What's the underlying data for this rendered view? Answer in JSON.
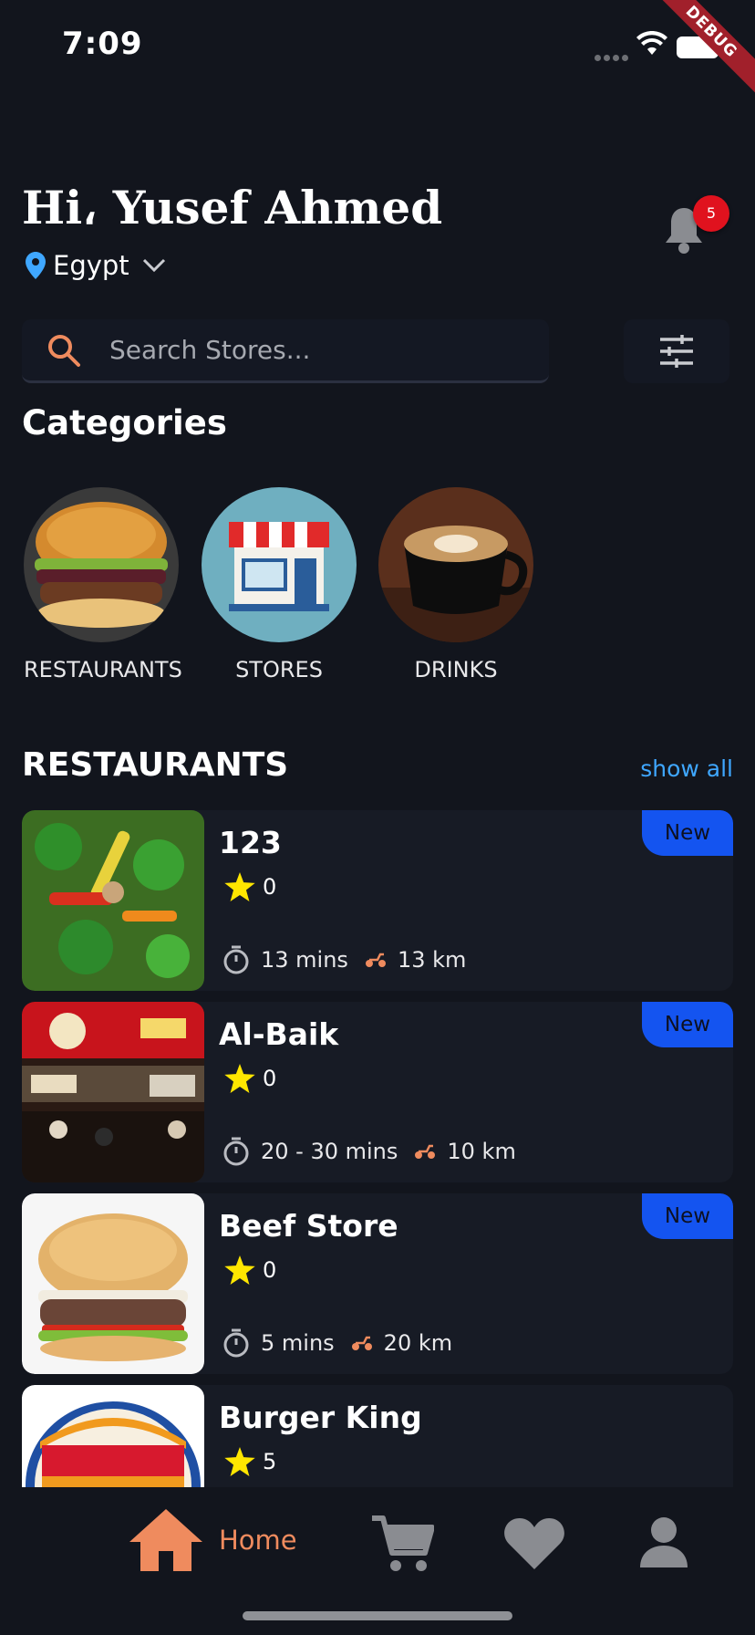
{
  "status_bar": {
    "time": "7:09",
    "debug_banner": "DEBUG"
  },
  "header": {
    "greeting": "Hi، Yusef Ahmed",
    "location": "Egypt",
    "notification_count": "5"
  },
  "search": {
    "placeholder": "Search Stores..."
  },
  "categories": {
    "title": "Categories",
    "items": [
      {
        "label": "RESTAURANTS",
        "icon": "burger-image"
      },
      {
        "label": "STORES",
        "icon": "storefront-image"
      },
      {
        "label": "DRINKS",
        "icon": "coffee-image"
      }
    ]
  },
  "restaurants": {
    "title": "RESTAURANTS",
    "show_all": "show all",
    "items": [
      {
        "name": "123",
        "rating": "0",
        "time": "13 mins",
        "distance": "13 km",
        "tag": "New"
      },
      {
        "name": "Al-Baik",
        "rating": "0",
        "time": "20 - 30 mins",
        "distance": "10 km",
        "tag": "New"
      },
      {
        "name": "Beef Store",
        "rating": "0",
        "time": "5 mins",
        "distance": "20 km",
        "tag": "New"
      },
      {
        "name": "Burger King",
        "rating": "5"
      }
    ]
  },
  "bottom_nav": {
    "home_label": "Home",
    "items": [
      "home-icon",
      "cart-icon",
      "heart-icon",
      "profile-icon"
    ]
  },
  "colors": {
    "background": "#12151d",
    "card": "#171b25",
    "accent": "#ef8b5e",
    "link": "#3fa7ff",
    "new_badge": "#1454f0",
    "star": "#ffe600",
    "notification": "#e0121e"
  }
}
